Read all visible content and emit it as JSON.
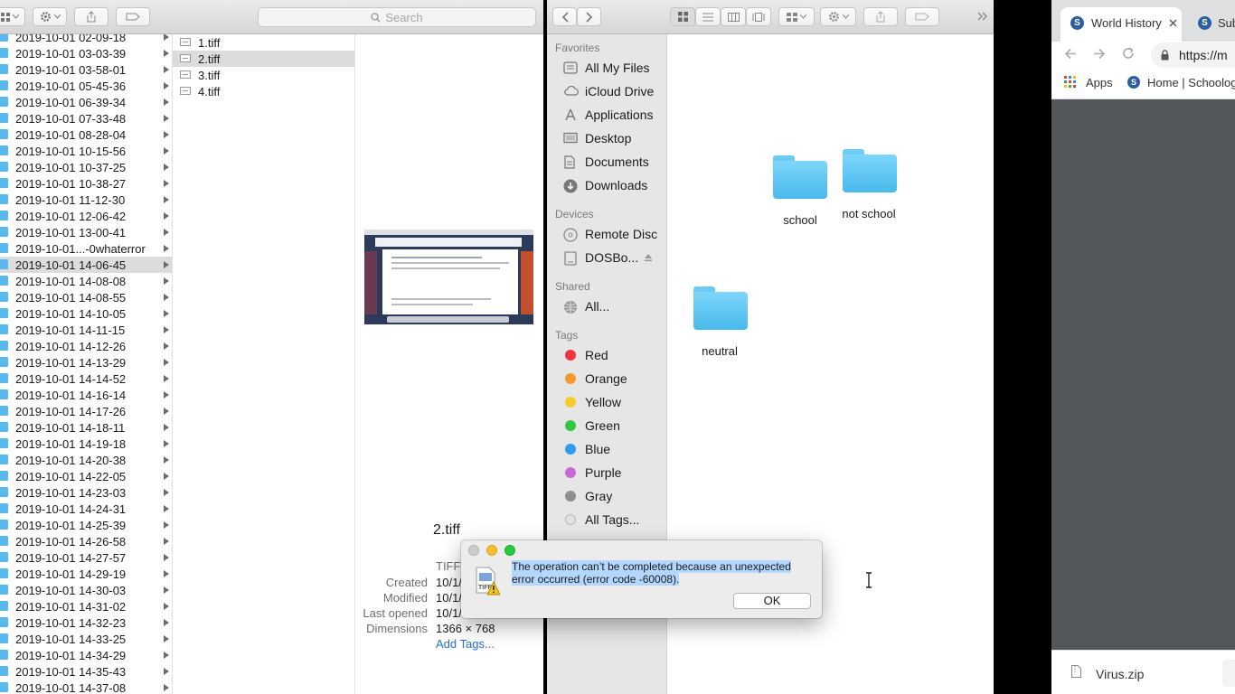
{
  "left_finder": {
    "search_placeholder": "Search",
    "folders": [
      "2019-10-01 02-09-18",
      "2019-10-01 03-03-39",
      "2019-10-01 03-58-01",
      "2019-10-01 05-45-36",
      "2019-10-01 06-39-34",
      "2019-10-01 07-33-48",
      "2019-10-01 08-28-04",
      "2019-10-01 10-15-56",
      "2019-10-01 10-37-25",
      "2019-10-01 10-38-27",
      "2019-10-01 11-12-30",
      "2019-10-01 12-06-42",
      "2019-10-01 13-00-41",
      "2019-10-01...-0whaterror",
      "2019-10-01 14-06-45",
      "2019-10-01 14-08-08",
      "2019-10-01 14-08-55",
      "2019-10-01 14-10-05",
      "2019-10-01 14-11-15",
      "2019-10-01 14-12-26",
      "2019-10-01 14-13-29",
      "2019-10-01 14-14-52",
      "2019-10-01 14-16-14",
      "2019-10-01 14-17-26",
      "2019-10-01 14-18-11",
      "2019-10-01 14-19-18",
      "2019-10-01 14-20-38",
      "2019-10-01 14-22-05",
      "2019-10-01 14-23-03",
      "2019-10-01 14-24-31",
      "2019-10-01 14-25-39",
      "2019-10-01 14-26-58",
      "2019-10-01 14-27-57",
      "2019-10-01 14-29-19",
      "2019-10-01 14-30-03",
      "2019-10-01 14-31-02",
      "2019-10-01 14-32-23",
      "2019-10-01 14-33-25",
      "2019-10-01 14-34-29",
      "2019-10-01 14-35-43",
      "2019-10-01 14-37-08"
    ],
    "selected_folder": "2019-10-01 14-06-45",
    "files": [
      "1.tiff",
      "2.tiff",
      "3.tiff",
      "4.tiff"
    ],
    "selected_file": "2.tiff",
    "preview": {
      "name": "2.tiff",
      "kind": "TIFF",
      "created_label": "Created",
      "created_value": "10/1/",
      "modified_label": "Modified",
      "modified_value": "10/1/",
      "last_opened_label": "Last opened",
      "last_opened_value": "10/1/",
      "dimensions_label": "Dimensions",
      "dimensions_value": "1366 × 768",
      "add_tags": "Add Tags..."
    }
  },
  "right_finder": {
    "sidebar": {
      "favorites_header": "Favorites",
      "favorites": [
        {
          "label": "All My Files",
          "icon": "all-files-icon"
        },
        {
          "label": "iCloud Drive",
          "icon": "cloud-icon"
        },
        {
          "label": "Applications",
          "icon": "applications-icon"
        },
        {
          "label": "Desktop",
          "icon": "desktop-icon"
        },
        {
          "label": "Documents",
          "icon": "documents-icon"
        },
        {
          "label": "Downloads",
          "icon": "downloads-icon"
        }
      ],
      "devices_header": "Devices",
      "devices": [
        {
          "label": "Remote Disc",
          "icon": "disc-icon"
        },
        {
          "label": "DOSBo...",
          "icon": "drive-icon"
        }
      ],
      "shared_header": "Shared",
      "shared": [
        {
          "label": "All...",
          "icon": "network-icon"
        }
      ],
      "tags_header": "Tags",
      "tags": [
        {
          "label": "Red",
          "color": "#f0353d"
        },
        {
          "label": "Orange",
          "color": "#f39a2a"
        },
        {
          "label": "Yellow",
          "color": "#f5cc2b"
        },
        {
          "label": "Green",
          "color": "#33c63f"
        },
        {
          "label": "Blue",
          "color": "#2d9cf0"
        },
        {
          "label": "Purple",
          "color": "#c869d8"
        },
        {
          "label": "Gray",
          "color": "#8e8e8e"
        }
      ],
      "all_tags": "All Tags..."
    },
    "folders": [
      "school",
      "not school",
      "neutral"
    ]
  },
  "browser": {
    "tabs": [
      {
        "title": "World History"
      },
      {
        "title": "Sub"
      }
    ],
    "url": "https://m",
    "bookmarks": [
      "Apps",
      "Home | Schoolog"
    ],
    "download_file": "Virus.zip"
  },
  "dialog": {
    "message": "The operation can’t be completed because an unexpected error occurred (error code -60008).",
    "ok_label": "OK",
    "icon_badge": "TIFF"
  },
  "colors": {
    "folder_blue": "#57b9ee",
    "selection": "#b3d7ff",
    "close_light": "#c8c8c8",
    "minimize_light": "#f5be2b",
    "zoom_light": "#27c93f"
  }
}
